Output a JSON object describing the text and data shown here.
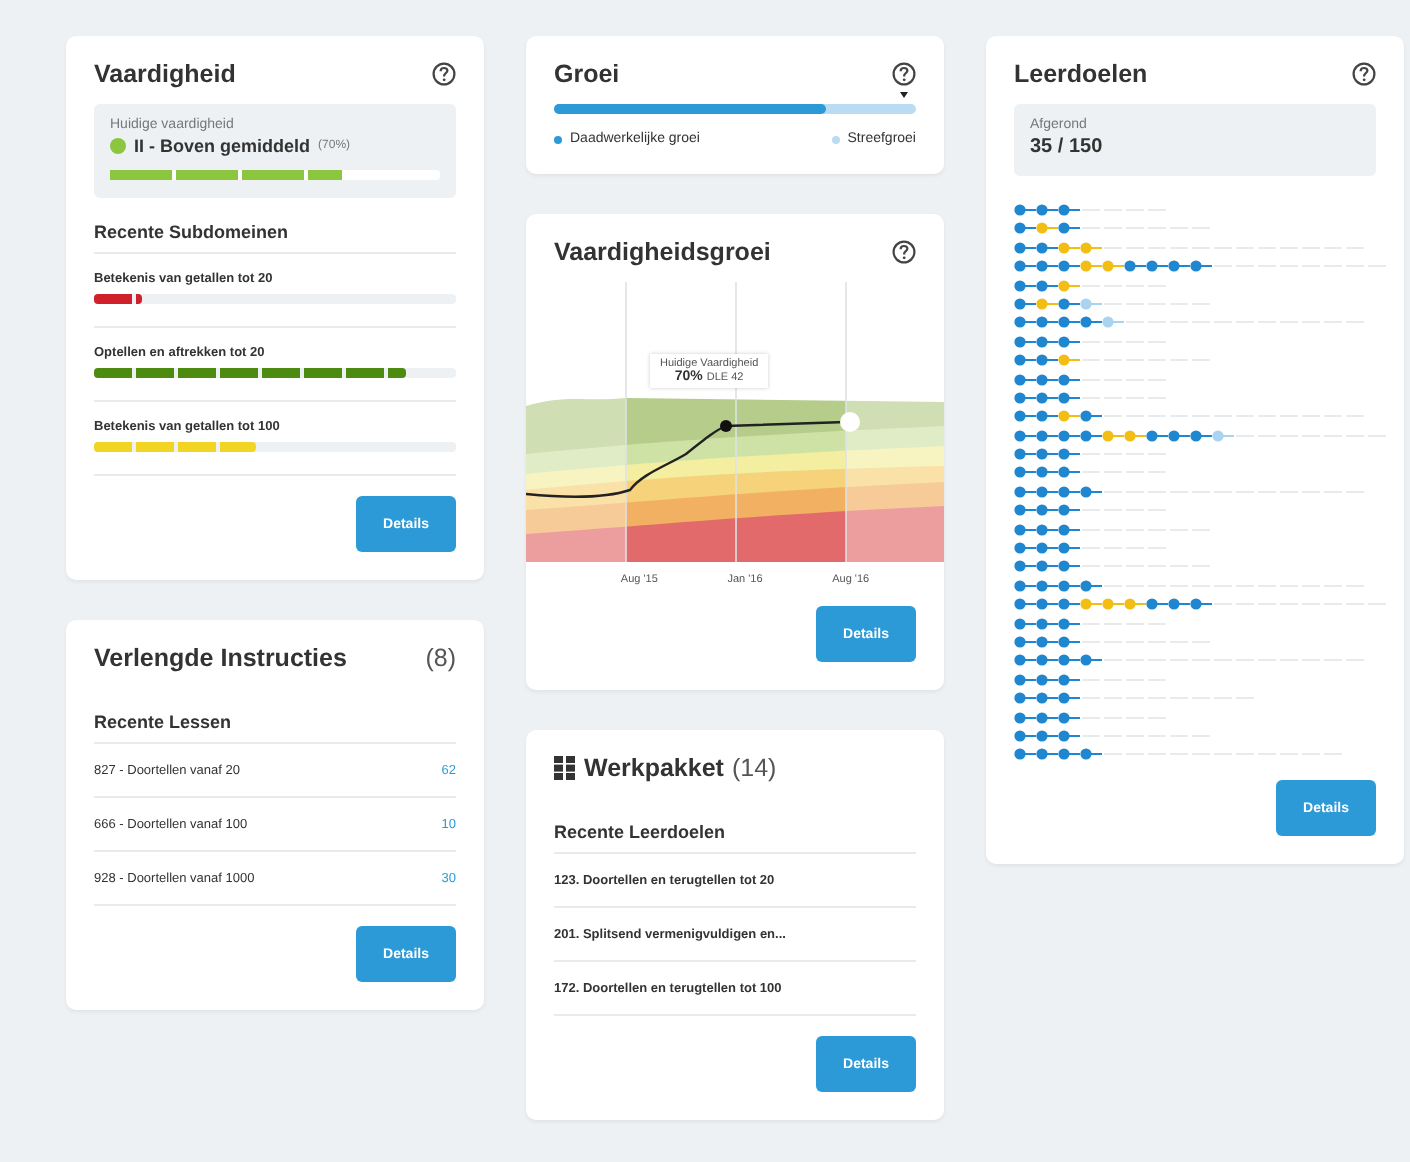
{
  "skill": {
    "title": "Vaardigheid",
    "current_label": "Huidige vaardigheid",
    "color": "#8cc63f",
    "current_value": "II - Boven gemiddeld",
    "current_percent": "(70%)",
    "level": 0.7,
    "subdomains_heading": "Recente Subdomeinen",
    "subdomains": [
      {
        "name": "Betekenis van getallen tot 20",
        "level": 0.13,
        "color": "#d0202a"
      },
      {
        "name": "Optellen en aftrekken tot 20",
        "level": 0.86,
        "color": "#4d8a10"
      },
      {
        "name": "Betekenis van getallen tot 100",
        "level": 0.45,
        "color": "#f2d422"
      }
    ],
    "button": "Details"
  },
  "growth": {
    "title": "Groei",
    "level": 0.75,
    "legend": [
      {
        "label": "Daadwerkelijke groei",
        "kind": "actual"
      },
      {
        "label": "Streefgroei",
        "kind": "target"
      }
    ]
  },
  "skill_growth": {
    "title": "Vaardigheidsgroei",
    "tooltip_label": "Huidige Vaardigheid",
    "tooltip_value": "70%",
    "tooltip_detail": "DLE 42",
    "x_labels": [
      "Aug '15",
      "Jan '16",
      "Aug '16"
    ],
    "button": "Details"
  },
  "objectives": {
    "title": "Leerdoelen",
    "completed_label": "Afgerond",
    "completed_value": "35 / 150",
    "button": "Details",
    "rows": [
      {
        "dots": [
          {
            "kind": "done"
          },
          {
            "kind": "done"
          },
          {
            "kind": "done"
          },
          {
            "kind": "open"
          },
          {
            "kind": "open"
          },
          {
            "kind": "open"
          },
          {
            "kind": "open"
          }
        ]
      },
      {
        "dots": [
          {
            "kind": "done"
          },
          {
            "kind": "review"
          },
          {
            "kind": "done"
          },
          {
            "kind": "open"
          },
          {
            "kind": "open"
          },
          {
            "kind": "open"
          },
          {
            "kind": "open"
          },
          {
            "kind": "open"
          },
          {
            "kind": "open"
          }
        ]
      },
      {
        "dots": [
          {
            "kind": "done"
          },
          {
            "kind": "done"
          },
          {
            "kind": "review"
          },
          {
            "kind": "review"
          },
          {
            "kind": "open"
          },
          {
            "kind": "open"
          },
          {
            "kind": "open"
          },
          {
            "kind": "open"
          },
          {
            "kind": "open"
          },
          {
            "kind": "open"
          },
          {
            "kind": "open"
          },
          {
            "kind": "open"
          },
          {
            "kind": "open"
          },
          {
            "kind": "open"
          },
          {
            "kind": "open"
          },
          {
            "kind": "open"
          }
        ]
      },
      {
        "dots": [
          {
            "kind": "done"
          },
          {
            "kind": "done"
          },
          {
            "kind": "done"
          },
          {
            "kind": "review"
          },
          {
            "kind": "review"
          },
          {
            "kind": "done"
          },
          {
            "kind": "done"
          },
          {
            "kind": "done"
          },
          {
            "kind": "done"
          },
          {
            "kind": "open"
          },
          {
            "kind": "open"
          },
          {
            "kind": "open"
          },
          {
            "kind": "open"
          },
          {
            "kind": "open"
          },
          {
            "kind": "open"
          },
          {
            "kind": "open"
          },
          {
            "kind": "open"
          }
        ]
      },
      {
        "dots": [
          {
            "kind": "done"
          },
          {
            "kind": "done"
          },
          {
            "kind": "review"
          },
          {
            "kind": "open"
          },
          {
            "kind": "open"
          },
          {
            "kind": "open"
          },
          {
            "kind": "open"
          }
        ]
      },
      {
        "dots": [
          {
            "kind": "done"
          },
          {
            "kind": "review"
          },
          {
            "kind": "done"
          },
          {
            "kind": "started"
          },
          {
            "kind": "open"
          },
          {
            "kind": "open"
          },
          {
            "kind": "open"
          },
          {
            "kind": "open"
          },
          {
            "kind": "open"
          }
        ]
      },
      {
        "dots": [
          {
            "kind": "done"
          },
          {
            "kind": "done"
          },
          {
            "kind": "done"
          },
          {
            "kind": "done"
          },
          {
            "kind": "started"
          },
          {
            "kind": "open"
          },
          {
            "kind": "open"
          },
          {
            "kind": "open"
          },
          {
            "kind": "open"
          },
          {
            "kind": "open"
          },
          {
            "kind": "open"
          },
          {
            "kind": "open"
          },
          {
            "kind": "open"
          },
          {
            "kind": "open"
          },
          {
            "kind": "open"
          },
          {
            "kind": "open"
          }
        ]
      },
      {
        "dots": [
          {
            "kind": "done"
          },
          {
            "kind": "done"
          },
          {
            "kind": "done"
          },
          {
            "kind": "open"
          },
          {
            "kind": "open"
          },
          {
            "kind": "open"
          },
          {
            "kind": "open"
          }
        ]
      },
      {
        "dots": [
          {
            "kind": "done"
          },
          {
            "kind": "done"
          },
          {
            "kind": "review"
          },
          {
            "kind": "open"
          },
          {
            "kind": "open"
          },
          {
            "kind": "open"
          },
          {
            "kind": "open"
          },
          {
            "kind": "open"
          },
          {
            "kind": "open"
          }
        ]
      },
      {
        "dots": [
          {
            "kind": "done"
          },
          {
            "kind": "done"
          },
          {
            "kind": "done"
          },
          {
            "kind": "open"
          },
          {
            "kind": "open"
          },
          {
            "kind": "open"
          },
          {
            "kind": "open"
          }
        ]
      },
      {
        "dots": [
          {
            "kind": "done"
          },
          {
            "kind": "done"
          },
          {
            "kind": "done"
          },
          {
            "kind": "open"
          },
          {
            "kind": "open"
          },
          {
            "kind": "open"
          },
          {
            "kind": "open"
          }
        ]
      },
      {
        "dots": [
          {
            "kind": "done"
          },
          {
            "kind": "done"
          },
          {
            "kind": "review"
          },
          {
            "kind": "done"
          },
          {
            "kind": "open"
          },
          {
            "kind": "open"
          },
          {
            "kind": "open"
          },
          {
            "kind": "open"
          },
          {
            "kind": "open"
          },
          {
            "kind": "open"
          },
          {
            "kind": "open"
          },
          {
            "kind": "open"
          },
          {
            "kind": "open"
          },
          {
            "kind": "open"
          },
          {
            "kind": "open"
          },
          {
            "kind": "open"
          }
        ]
      },
      {
        "dots": [
          {
            "kind": "done"
          },
          {
            "kind": "done"
          },
          {
            "kind": "done"
          },
          {
            "kind": "done"
          },
          {
            "kind": "review"
          },
          {
            "kind": "review"
          },
          {
            "kind": "done"
          },
          {
            "kind": "done"
          },
          {
            "kind": "done"
          },
          {
            "kind": "started"
          },
          {
            "kind": "open"
          },
          {
            "kind": "open"
          },
          {
            "kind": "open"
          },
          {
            "kind": "open"
          },
          {
            "kind": "open"
          },
          {
            "kind": "open"
          },
          {
            "kind": "open"
          }
        ]
      },
      {
        "dots": [
          {
            "kind": "done"
          },
          {
            "kind": "done"
          },
          {
            "kind": "done"
          },
          {
            "kind": "open"
          },
          {
            "kind": "open"
          },
          {
            "kind": "open"
          },
          {
            "kind": "open"
          }
        ]
      },
      {
        "dots": [
          {
            "kind": "done"
          },
          {
            "kind": "done"
          },
          {
            "kind": "done"
          },
          {
            "kind": "open"
          },
          {
            "kind": "open"
          },
          {
            "kind": "open"
          },
          {
            "kind": "open"
          }
        ]
      },
      {
        "dots": [
          {
            "kind": "done"
          },
          {
            "kind": "done"
          },
          {
            "kind": "done"
          },
          {
            "kind": "done"
          },
          {
            "kind": "open"
          },
          {
            "kind": "open"
          },
          {
            "kind": "open"
          },
          {
            "kind": "open"
          },
          {
            "kind": "open"
          },
          {
            "kind": "open"
          },
          {
            "kind": "open"
          },
          {
            "kind": "open"
          },
          {
            "kind": "open"
          },
          {
            "kind": "open"
          },
          {
            "kind": "open"
          },
          {
            "kind": "open"
          }
        ]
      },
      {
        "dots": [
          {
            "kind": "done"
          },
          {
            "kind": "done"
          },
          {
            "kind": "done"
          },
          {
            "kind": "open"
          },
          {
            "kind": "open"
          },
          {
            "kind": "open"
          },
          {
            "kind": "open"
          }
        ]
      },
      {
        "dots": [
          {
            "kind": "done"
          },
          {
            "kind": "done"
          },
          {
            "kind": "done"
          },
          {
            "kind": "open"
          },
          {
            "kind": "open"
          },
          {
            "kind": "open"
          },
          {
            "kind": "open"
          },
          {
            "kind": "open"
          },
          {
            "kind": "open"
          }
        ]
      },
      {
        "dots": [
          {
            "kind": "done"
          },
          {
            "kind": "done"
          },
          {
            "kind": "done"
          },
          {
            "kind": "open"
          },
          {
            "kind": "open"
          },
          {
            "kind": "open"
          },
          {
            "kind": "open"
          }
        ]
      },
      {
        "dots": [
          {
            "kind": "done"
          },
          {
            "kind": "done"
          },
          {
            "kind": "done"
          },
          {
            "kind": "open"
          },
          {
            "kind": "open"
          },
          {
            "kind": "open"
          },
          {
            "kind": "open"
          },
          {
            "kind": "open"
          },
          {
            "kind": "open"
          }
        ]
      },
      {
        "dots": [
          {
            "kind": "done"
          },
          {
            "kind": "done"
          },
          {
            "kind": "done"
          },
          {
            "kind": "done"
          },
          {
            "kind": "open"
          },
          {
            "kind": "open"
          },
          {
            "kind": "open"
          },
          {
            "kind": "open"
          },
          {
            "kind": "open"
          },
          {
            "kind": "open"
          },
          {
            "kind": "open"
          },
          {
            "kind": "open"
          },
          {
            "kind": "open"
          },
          {
            "kind": "open"
          },
          {
            "kind": "open"
          },
          {
            "kind": "open"
          }
        ]
      },
      {
        "dots": [
          {
            "kind": "done"
          },
          {
            "kind": "done"
          },
          {
            "kind": "done"
          },
          {
            "kind": "review"
          },
          {
            "kind": "review"
          },
          {
            "kind": "review"
          },
          {
            "kind": "done"
          },
          {
            "kind": "done"
          },
          {
            "kind": "done"
          },
          {
            "kind": "open"
          },
          {
            "kind": "open"
          },
          {
            "kind": "open"
          },
          {
            "kind": "open"
          },
          {
            "kind": "open"
          },
          {
            "kind": "open"
          },
          {
            "kind": "open"
          },
          {
            "kind": "open"
          }
        ]
      },
      {
        "dots": [
          {
            "kind": "done"
          },
          {
            "kind": "done"
          },
          {
            "kind": "done"
          },
          {
            "kind": "open"
          },
          {
            "kind": "open"
          },
          {
            "kind": "open"
          },
          {
            "kind": "open"
          }
        ]
      },
      {
        "dots": [
          {
            "kind": "done"
          },
          {
            "kind": "done"
          },
          {
            "kind": "done"
          },
          {
            "kind": "open"
          },
          {
            "kind": "open"
          },
          {
            "kind": "open"
          },
          {
            "kind": "open"
          },
          {
            "kind": "open"
          },
          {
            "kind": "open"
          }
        ]
      },
      {
        "dots": [
          {
            "kind": "done"
          },
          {
            "kind": "done"
          },
          {
            "kind": "done"
          },
          {
            "kind": "done"
          },
          {
            "kind": "open"
          },
          {
            "kind": "open"
          },
          {
            "kind": "open"
          },
          {
            "kind": "open"
          },
          {
            "kind": "open"
          },
          {
            "kind": "open"
          },
          {
            "kind": "open"
          },
          {
            "kind": "open"
          },
          {
            "kind": "open"
          },
          {
            "kind": "open"
          },
          {
            "kind": "open"
          },
          {
            "kind": "open"
          }
        ]
      },
      {
        "dots": [
          {
            "kind": "done"
          },
          {
            "kind": "done"
          },
          {
            "kind": "done"
          },
          {
            "kind": "open"
          },
          {
            "kind": "open"
          },
          {
            "kind": "open"
          },
          {
            "kind": "open"
          }
        ]
      },
      {
        "dots": [
          {
            "kind": "done"
          },
          {
            "kind": "done"
          },
          {
            "kind": "done"
          },
          {
            "kind": "open"
          },
          {
            "kind": "open"
          },
          {
            "kind": "open"
          },
          {
            "kind": "open"
          },
          {
            "kind": "open"
          },
          {
            "kind": "open"
          },
          {
            "kind": "open"
          },
          {
            "kind": "open"
          }
        ]
      },
      {
        "dots": [
          {
            "kind": "done"
          },
          {
            "kind": "done"
          },
          {
            "kind": "done"
          },
          {
            "kind": "open"
          },
          {
            "kind": "open"
          },
          {
            "kind": "open"
          },
          {
            "kind": "open"
          }
        ]
      },
      {
        "dots": [
          {
            "kind": "done"
          },
          {
            "kind": "done"
          },
          {
            "kind": "done"
          },
          {
            "kind": "open"
          },
          {
            "kind": "open"
          },
          {
            "kind": "open"
          },
          {
            "kind": "open"
          },
          {
            "kind": "open"
          },
          {
            "kind": "open"
          }
        ]
      },
      {
        "dots": [
          {
            "kind": "done"
          },
          {
            "kind": "done"
          },
          {
            "kind": "done"
          },
          {
            "kind": "done"
          },
          {
            "kind": "open"
          },
          {
            "kind": "open"
          },
          {
            "kind": "open"
          },
          {
            "kind": "open"
          },
          {
            "kind": "open"
          },
          {
            "kind": "open"
          },
          {
            "kind": "open"
          },
          {
            "kind": "open"
          },
          {
            "kind": "open"
          },
          {
            "kind": "open"
          },
          {
            "kind": "open"
          }
        ]
      }
    ]
  },
  "instructions": {
    "title": "Verlengde Instructies",
    "count": "(8)",
    "subheading": "Recente Lessen",
    "button": "Details",
    "lessons": [
      {
        "name": "827 - Doortellen vanaf 20",
        "value": "62"
      },
      {
        "name": "666 - Doortellen vanaf 100",
        "value": "10"
      },
      {
        "name": "928 - Doortellen vanaf 1000",
        "value": "30"
      }
    ]
  },
  "workpackage": {
    "title": "Werkpakket",
    "count": "(14)",
    "subheading": "Recente Leerdoelen",
    "button": "Details",
    "items": [
      "123. Doortellen en terugtellen tot 20",
      "201. Splitsend vermenigvuldigen en...",
      "172. Doortellen en terugtellen tot 100"
    ]
  }
}
